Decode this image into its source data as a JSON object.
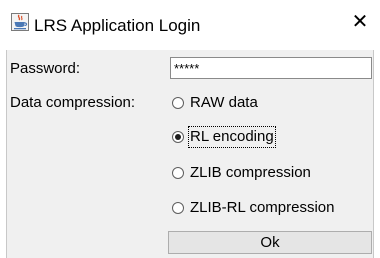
{
  "window": {
    "title": "LRS Application Login",
    "close_glyph": "✕",
    "app_icon": "java-cup-icon"
  },
  "form": {
    "password_label": "Password:",
    "password_value": "*****",
    "compression_label": "Data compression:",
    "options": [
      {
        "label": "RAW data",
        "selected": false
      },
      {
        "label": "RL encoding",
        "selected": true
      },
      {
        "label": "ZLIB compression",
        "selected": false
      },
      {
        "label": "ZLIB-RL compression",
        "selected": false
      }
    ],
    "ok_label": "Ok"
  },
  "colors": {
    "dialog_background": "#f0f0f0",
    "button_background": "#e5e5e5"
  }
}
